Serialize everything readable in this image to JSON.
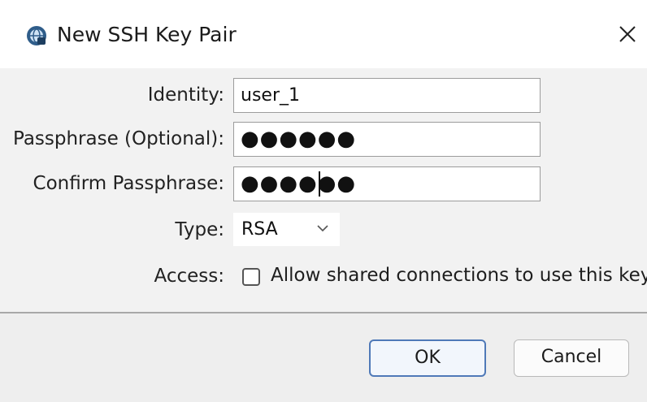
{
  "window": {
    "title": "New SSH Key Pair",
    "app_icon": "ssh-globe-icon",
    "close_glyph": "✕"
  },
  "form": {
    "identity_label": "Identity:",
    "identity_value": "user_1",
    "passphrase_label": "Passphrase (Optional):",
    "passphrase_mask": "●●●●●●",
    "confirm_label": "Confirm Passphrase:",
    "confirm_mask": "●●●●●●",
    "type_label": "Type:",
    "type_value": "RSA",
    "access_label": "Access:",
    "access_checkbox_label": "Allow shared connections to use this key",
    "access_checked": false
  },
  "buttons": {
    "ok_label": "OK",
    "cancel_label": "Cancel"
  },
  "colors": {
    "content_bg": "#f2f2f2",
    "footer_bg": "#eeeeee",
    "ok_border": "#4f79b8"
  }
}
